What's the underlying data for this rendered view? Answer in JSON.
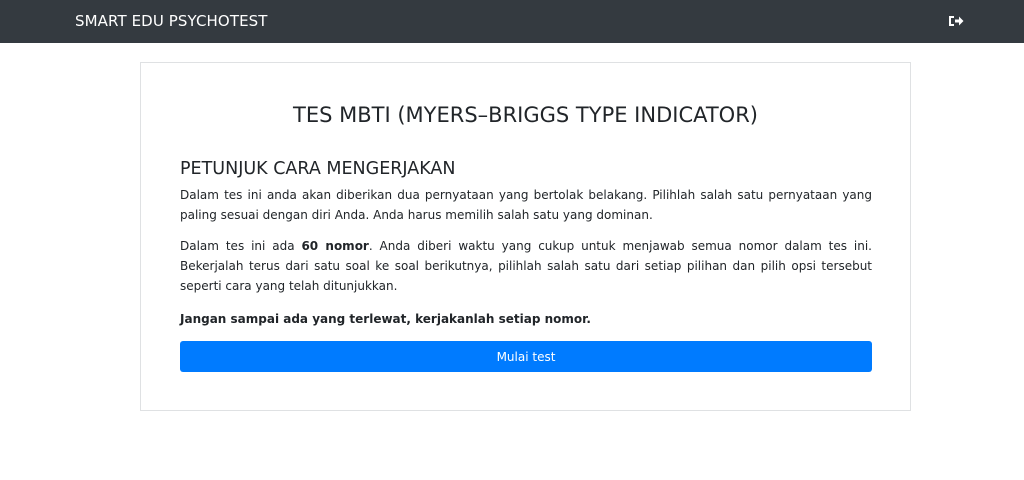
{
  "navbar": {
    "brand": "SMART EDU PSYCHOTEST",
    "logout_icon": "sign-out-icon"
  },
  "card": {
    "title": "TES MBTI (MYERS–BRIGGS TYPE INDICATOR)",
    "subtitle": "PETUNJUK CARA MENGERJAKAN",
    "paragraph1": "Dalam tes ini anda akan diberikan dua pernyataan yang bertolak belakang. Pilihlah salah satu pernyataan yang paling sesuai dengan diri Anda. Anda harus memilih salah satu yang dominan.",
    "paragraph2_before": "Dalam tes ini ada ",
    "paragraph2_bold": "60 nomor",
    "paragraph2_after": ". Anda diberi waktu yang cukup untuk menjawab semua nomor dalam tes ini. Bekerjalah terus dari satu soal ke soal berikutnya, pilihlah salah satu dari setiap pilihan dan pilih opsi tersebut seperti cara yang telah ditunjukkan.",
    "paragraph3": "Jangan sampai ada yang terlewat, kerjakanlah setiap nomor.",
    "start_button": "Mulai test"
  },
  "colors": {
    "navbar": "#343a40",
    "primary": "#007bff"
  }
}
